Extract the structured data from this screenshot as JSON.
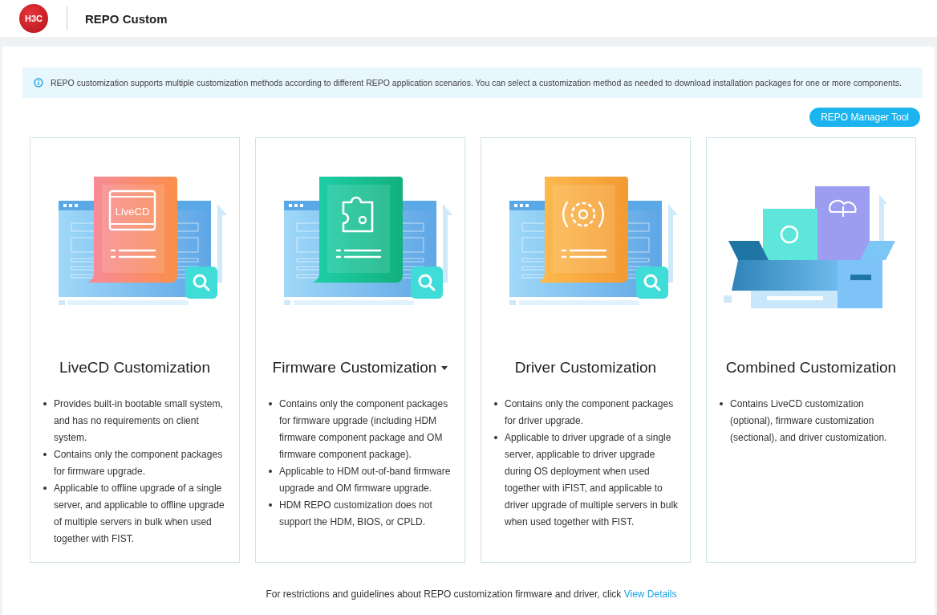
{
  "header": {
    "logo_text": "H3C",
    "title": "REPO Custom"
  },
  "notice": "REPO customization supports multiple customization methods according to different REPO application scenarios. You can select a customization method as needed to download installation packages for one or more components.",
  "tool_button": "REPO Manager Tool",
  "cards": [
    {
      "kind": "livecd",
      "art_label": "LiveCD",
      "title": "LiveCD Customization",
      "dropdown": false,
      "points": [
        "Provides built-in bootable small system, and has no requirements on client system.",
        "Contains only the component packages for firmware upgrade.",
        "Applicable to offline upgrade of a single server, and applicable to offline upgrade of multiple servers in bulk when used together with FIST."
      ]
    },
    {
      "kind": "firmware",
      "title": "Firmware Customization",
      "dropdown": true,
      "points": [
        "Contains only the component packages for firmware upgrade (including HDM firmware component package and OM firmware component package).",
        "Applicable to HDM out-of-band firmware upgrade and OM firmware upgrade.",
        "HDM REPO customization does not support the HDM, BIOS, or CPLD."
      ]
    },
    {
      "kind": "driver",
      "title": "Driver Customization",
      "dropdown": false,
      "points": [
        "Contains only the component packages for driver upgrade.",
        "Applicable to driver upgrade of a single server, applicable to driver upgrade during OS deployment when used together with iFIST, and applicable to driver upgrade of multiple servers in bulk when used together with FIST."
      ]
    },
    {
      "kind": "combined",
      "title": "Combined Customization",
      "dropdown": false,
      "points": [
        "Contains LiveCD customization (optional), firmware customization (sectional), and driver customization."
      ]
    }
  ],
  "footer": {
    "text": "For restrictions and guidelines about REPO customization firmware and driver, click",
    "link": "View Details"
  }
}
